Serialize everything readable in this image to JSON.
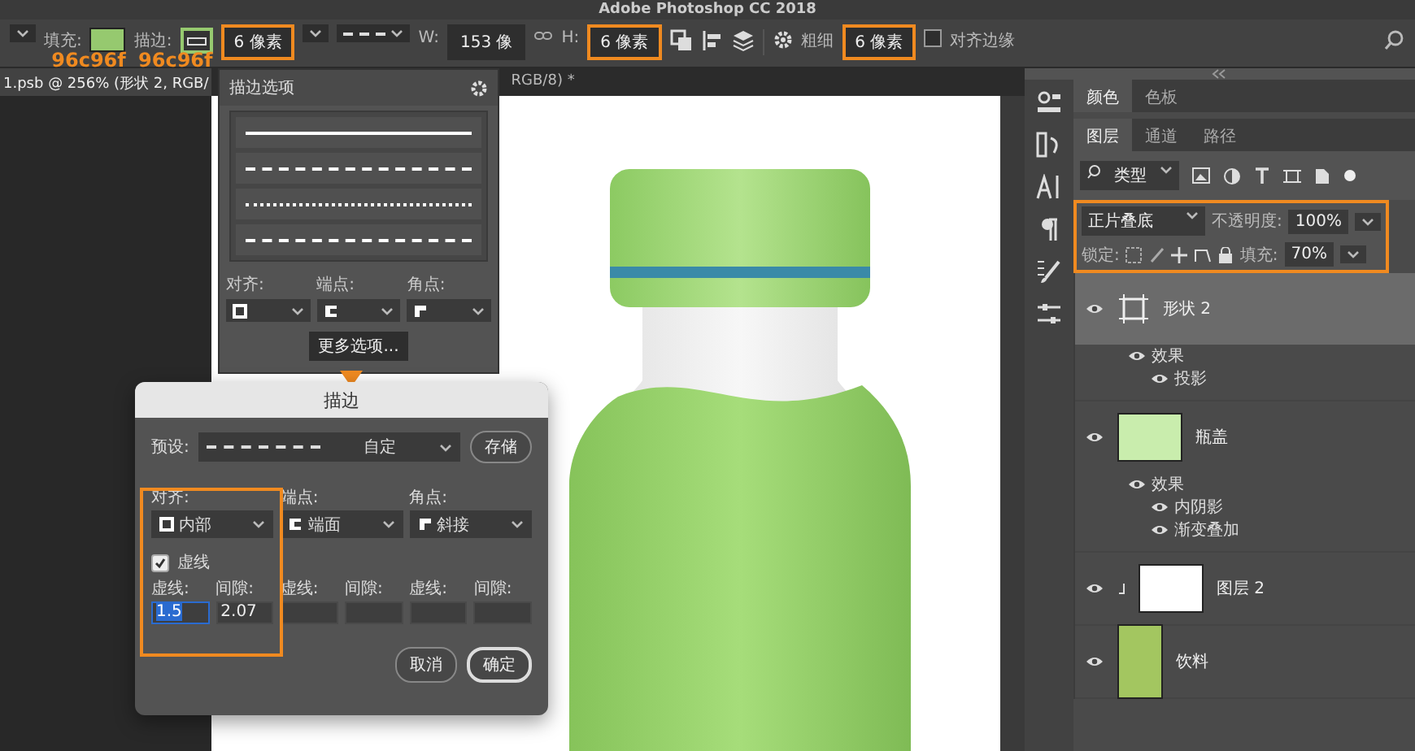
{
  "window": {
    "title": "Adobe Photoshop CC 2018"
  },
  "options_bar": {
    "fill_label": "填充:",
    "fill_note": "96c96f",
    "stroke_label": "描边:",
    "stroke_note": "96c96f",
    "stroke_width": {
      "value": "6 像素",
      "highlighted": true
    },
    "width_label": "W:",
    "width": {
      "value": "153 像",
      "highlighted": false
    },
    "height_label": "H:",
    "height": {
      "value": "6 像素",
      "highlighted": true
    },
    "weight_label": "粗细",
    "weight": {
      "value": "6 像素",
      "highlighted": true
    },
    "align_edges": {
      "label": "对齐边缘",
      "checked": false
    }
  },
  "doc_tabs": [
    {
      "label": "1.psb @ 256% (形状 2, RGB/",
      "selected": true
    },
    {
      "label": "RGB/8) *",
      "selected": false
    }
  ],
  "stroke_options": {
    "title": "描边选项",
    "presets": [
      {
        "kind": "solid"
      },
      {
        "kind": "dashed"
      },
      {
        "kind": "dotted"
      },
      {
        "kind": "long-dash"
      }
    ],
    "align_label": "对齐:",
    "caps_label": "端点:",
    "corners_label": "角点:",
    "more_button": "更多选项..."
  },
  "dialog": {
    "title": "描边",
    "preset_label": "预设:",
    "preset_value": "自定",
    "save_button": "存储",
    "align_label": "对齐:",
    "align_value": "内部",
    "align_highlighted": true,
    "caps_label": "端点:",
    "caps_value": "端面",
    "corners_label": "角点:",
    "corners_value": "斜接",
    "dashed": {
      "label": "虚线",
      "checked": true
    },
    "dash_fields": [
      {
        "label": "虚线:",
        "value": "1.5",
        "selected": true
      },
      {
        "label": "间隙:",
        "value": "2.07",
        "selected": false
      },
      {
        "label": "虚线:",
        "selected": false
      },
      {
        "label": "间隙:",
        "selected": false
      },
      {
        "label": "虚线:",
        "selected": false
      },
      {
        "label": "间隙:",
        "selected": false
      }
    ],
    "cancel_button": "取消",
    "ok_button": "确定"
  },
  "panels": {
    "top_tabs": [
      {
        "label": "颜色",
        "selected": true
      },
      {
        "label": "色板",
        "selected": false
      }
    ],
    "tabs": [
      {
        "label": "图层",
        "selected": true
      },
      {
        "label": "通道",
        "selected": false
      },
      {
        "label": "路径",
        "selected": false
      }
    ],
    "filter": "类型",
    "blend_mode": "正片叠底",
    "opacity_label": "不透明度:",
    "opacity": "100%",
    "lock_label": "锁定:",
    "fill_label": "填充:",
    "fill": "70%",
    "highlighted": true,
    "layers": [
      {
        "name": "形状 2",
        "kind": "shape",
        "selected": true,
        "effects_label": "效果",
        "effects": [
          "投影"
        ]
      },
      {
        "name": "瓶盖",
        "kind": "cap",
        "selected": false,
        "effects_label": "效果",
        "effects": [
          "内阴影",
          "渐变叠加"
        ]
      },
      {
        "name": "图层 2",
        "kind": "white",
        "selected": false
      },
      {
        "name": "饮料",
        "kind": "drink",
        "selected": false
      }
    ]
  }
}
